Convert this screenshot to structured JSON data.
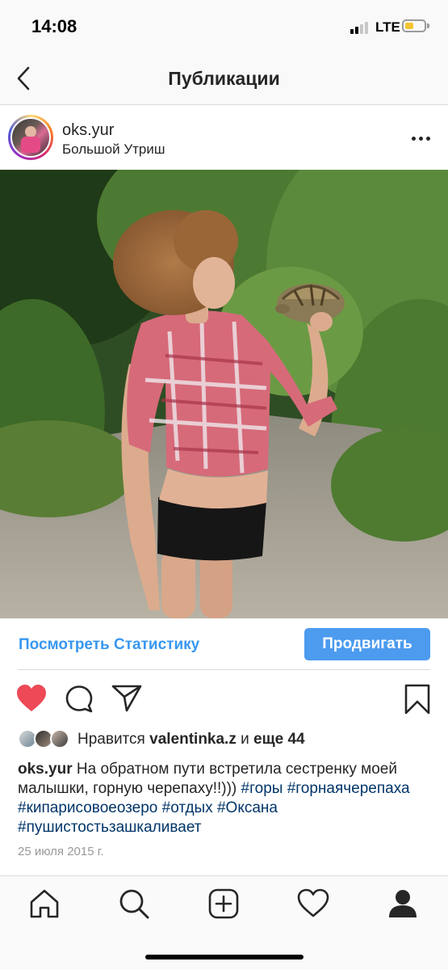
{
  "status_bar": {
    "time": "14:08",
    "network": "LTE",
    "battery_color": "#f4c430",
    "battery_level": 0.45,
    "signal_bars_active": 2,
    "signal_bars_total": 4
  },
  "header": {
    "title": "Публикации",
    "back_icon": "chevron-left-icon"
  },
  "post": {
    "username": "oks.yur",
    "location": "Большой Утриш",
    "more_icon": "more-horizontal-icon",
    "photo": "photo-woman-holding-turtle",
    "insights_label": "Посмотреть Статистику",
    "promote_label": "Продвигать",
    "actions": {
      "like_icon": "heart-filled-icon",
      "like_color": "#ed4956",
      "comment_icon": "comment-icon",
      "share_icon": "direct-share-icon",
      "save_icon": "bookmark-icon"
    },
    "likes": {
      "prefix": "Нравится",
      "liked_by": "valentinka.z",
      "connector": "и",
      "others": "еще 44"
    },
    "caption": {
      "username": "oks.yur",
      "text": "На обратном пути встретила сестренку моей малышки, горную черепаху!!)))",
      "hashtags": [
        "#горы",
        "#горнаячерепаха",
        "#кипарисовоеозеро",
        "#отдых",
        "#Оксана",
        "#пушистостьзашкаливает"
      ]
    },
    "date": "25 июля 2015 г."
  },
  "tab_bar": {
    "items": [
      {
        "name": "home",
        "icon": "home-icon"
      },
      {
        "name": "search",
        "icon": "search-icon"
      },
      {
        "name": "new-post",
        "icon": "plus-square-icon"
      },
      {
        "name": "activity",
        "icon": "heart-outline-icon"
      },
      {
        "name": "profile",
        "icon": "profile-icon"
      }
    ]
  },
  "colors": {
    "link_blue": "#3897f0",
    "promote_blue": "#4c9bef",
    "hashtag_blue": "#003569",
    "date_gray": "#999999"
  }
}
